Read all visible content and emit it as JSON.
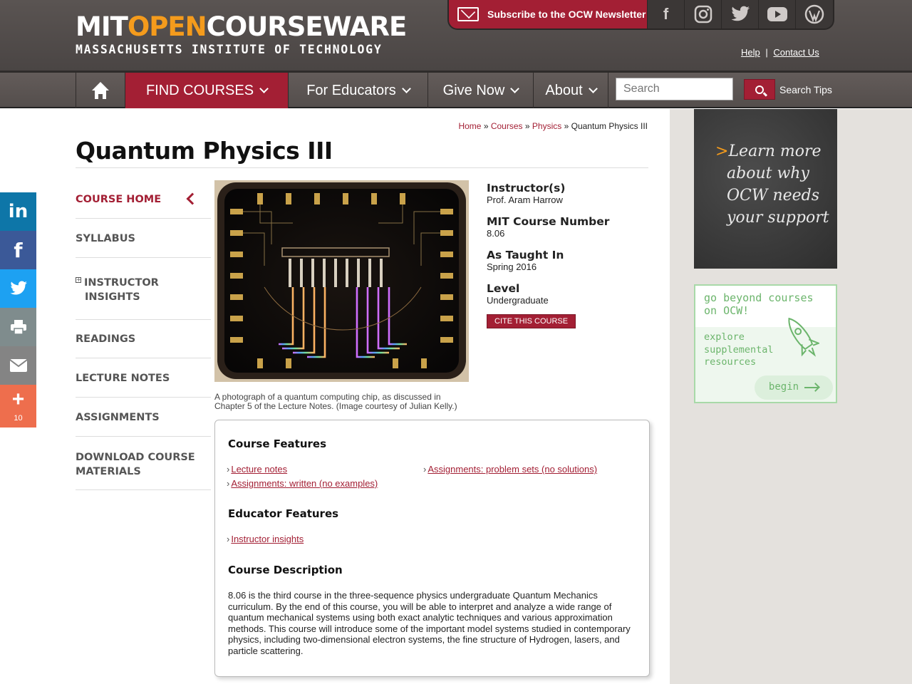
{
  "header": {
    "logo_mit": "MIT",
    "logo_open": "OPEN",
    "logo_courseware": "COURSEWARE",
    "logo_sub": "MASSACHUSETTS INSTITUTE OF TECHNOLOGY",
    "subscribe_label": "Subscribe to the OCW Newsletter",
    "help": "Help",
    "separator": "|",
    "contact": "Contact Us"
  },
  "nav": {
    "find_courses": "FIND COURSES",
    "for_educators": "For Educators",
    "give_now": "Give Now",
    "about": "About",
    "search_placeholder": "Search",
    "search_tips": "Search Tips"
  },
  "breadcrumb": {
    "home": "Home",
    "courses": "Courses",
    "physics": "Physics",
    "sep": "»",
    "current": "Quantum Physics III"
  },
  "page_title": "Quantum Physics III",
  "sidebar": {
    "items": [
      {
        "label": "COURSE HOME"
      },
      {
        "label": "SYLLABUS"
      },
      {
        "label_line1": "INSTRUCTOR",
        "label_line2": "INSIGHTS"
      },
      {
        "label": "READINGS"
      },
      {
        "label": "LECTURE NOTES"
      },
      {
        "label": "ASSIGNMENTS"
      },
      {
        "label_line1": "DOWNLOAD COURSE",
        "label_line2": "MATERIALS"
      }
    ]
  },
  "share": {
    "count": "10"
  },
  "image": {
    "caption": "A photograph of a quantum computing chip, as discussed in Chapter 5 of the Lecture Notes. (Image courtesy of Julian Kelly.)"
  },
  "info": {
    "instructor_label": "Instructor(s)",
    "instructor": "Prof. Aram Harrow",
    "number_label": "MIT Course Number",
    "number": "8.06",
    "taught_label": "As Taught In",
    "taught": "Spring 2016",
    "level_label": "Level",
    "level": "Undergraduate",
    "cite": "CITE THIS COURSE"
  },
  "features": {
    "course_features_title": "Course Features",
    "course_links": [
      "Lecture notes",
      "Assignments: problem sets (no solutions)",
      "Assignments: written (no examples)"
    ],
    "educator_features_title": "Educator Features",
    "educator_links": [
      "Instructor insights"
    ],
    "description_title": "Course Description",
    "description": "8.06 is the third course in the three-sequence physics undergraduate Quantum Mechanics curriculum. By the end of this course, you will be able to interpret and analyze a wide range of quantum mechanical systems using both exact analytic techniques and various approximation methods. This course will introduce some of the important model systems studied in contemporary physics, including two-dimensional electron systems, the fine structure of Hydrogen, lasers, and particle scattering."
  },
  "promo": {
    "chalk_lines": [
      "Learn more",
      "about why",
      "OCW needs",
      "your support"
    ],
    "chalk_arrow": ">",
    "beyond_line1": "go beyond courses",
    "beyond_line2": "on OCW!",
    "explore_line1": "explore",
    "explore_line2": "supplemental",
    "explore_line3": "resources",
    "begin": "begin"
  },
  "colors": {
    "accent": "#a31f34",
    "orange": "#f49b1c",
    "linkedin": "#0e76a8",
    "facebook": "#3b5998",
    "twitter": "#1da1f2",
    "print": "#7f8c8d",
    "email": "#848484",
    "more": "#ee6e4d"
  }
}
